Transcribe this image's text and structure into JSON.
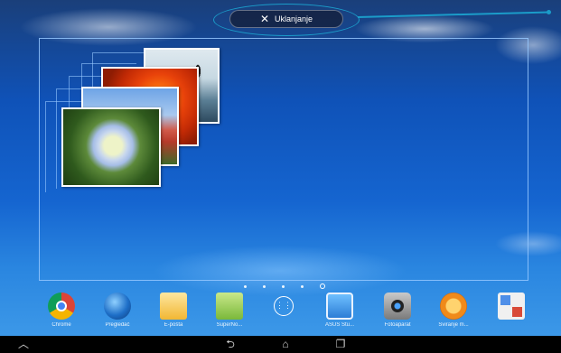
{
  "header": {
    "remove_label": "Uklanjanje",
    "remove_icon": "close-icon"
  },
  "callout_color": "#1b9cc9",
  "photo_stack": {
    "photos": [
      "penguins",
      "dahlia",
      "tulips",
      "hydrangea"
    ]
  },
  "pager": {
    "page_count": 5,
    "current_page": 5
  },
  "dock": {
    "apps": [
      {
        "label": "Chrome",
        "icon": "chrome-icon"
      },
      {
        "label": "Pregledač",
        "icon": "browser-icon"
      },
      {
        "label": "E-pošta",
        "icon": "email-icon"
      },
      {
        "label": "SuperNo...",
        "icon": "supernote-icon"
      },
      {
        "label": "",
        "icon": "all-apps-icon"
      },
      {
        "label": "ASUS Stu...",
        "icon": "asus-studio-icon"
      },
      {
        "label": "Fotoaparat",
        "icon": "camera-icon"
      },
      {
        "label": "Sviranje m...",
        "icon": "play-music-icon"
      },
      {
        "label": "",
        "icon": "google-folder-icon"
      }
    ]
  },
  "navbar": {
    "buttons": [
      "back-icon",
      "home-icon",
      "recent-apps-icon"
    ]
  }
}
